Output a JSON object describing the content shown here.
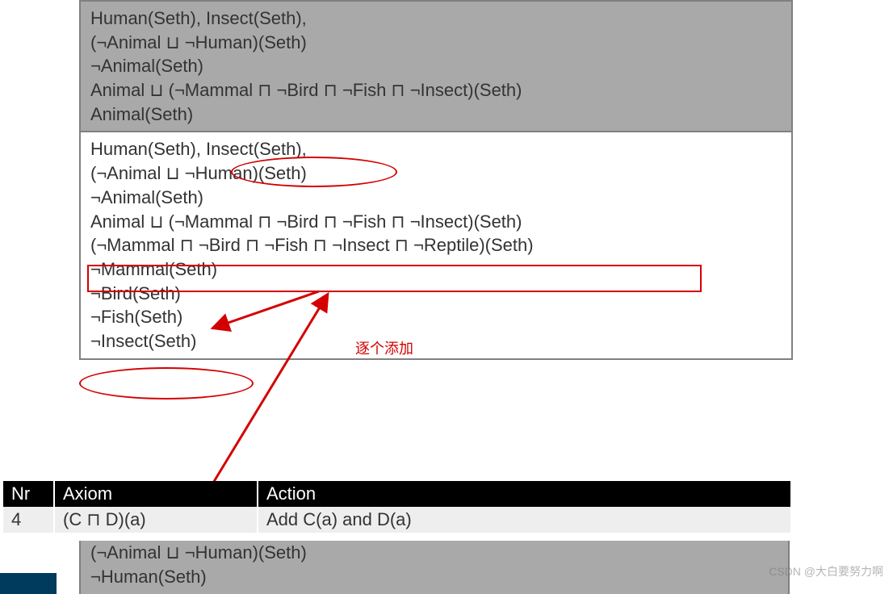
{
  "top_gray": {
    "l1": "Human(Seth), Insect(Seth),",
    "l2": "(¬Animal ⊔ ¬Human)(Seth)",
    "l3": "¬Animal(Seth)",
    "l4": "Animal ⊔ (¬Mammal ⊓ ¬Bird ⊓ ¬Fish ⊓ ¬Insect)(Seth)",
    "l5": "Animal(Seth)"
  },
  "mid_white": {
    "l1": "Human(Seth), Insect(Seth),",
    "l2": "(¬Animal ⊔ ¬Human)(Seth)",
    "l3": "¬Animal(Seth)",
    "l4": "Animal ⊔ (¬Mammal ⊓ ¬Bird ⊓ ¬Fish ⊓ ¬Insect)(Seth)",
    "l5": "(¬Mammal ⊓ ¬Bird ⊓ ¬Fish ⊓ ¬Insect ⊓ ¬Reptile)(Seth)",
    "l6": "¬Mammal(Seth)",
    "l7": "¬Bird(Seth)",
    "l8": "¬Fish(Seth)",
    "l9": "¬Insect(Seth)"
  },
  "annotation_text": "逐个添加",
  "table": {
    "headers": {
      "nr": "Nr",
      "axiom": "Axiom",
      "action": "Action"
    },
    "row": {
      "nr": "4",
      "axiom": "(C ⊓ D)(a)",
      "action": "Add C(a) and D(a)"
    }
  },
  "bottom_gray": {
    "l1": "(¬Animal ⊔ ¬Human)(Seth)",
    "l2": "¬Human(Seth)"
  },
  "watermark": "CSDN @大白要努力啊"
}
